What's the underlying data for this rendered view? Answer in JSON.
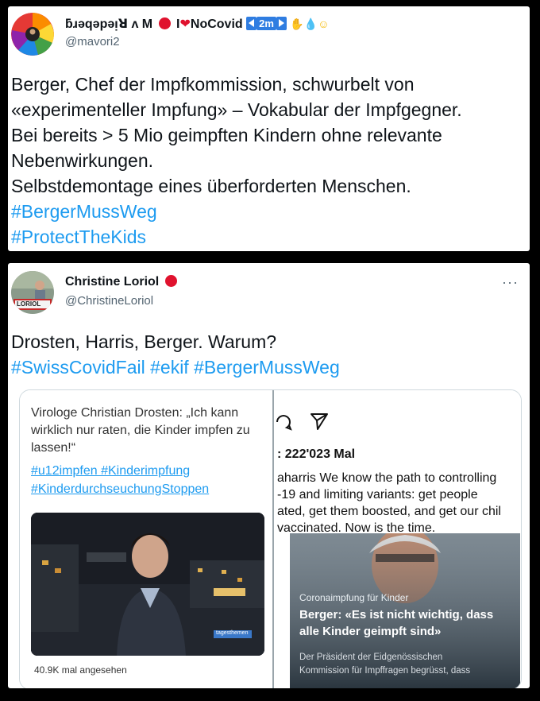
{
  "tweet1": {
    "display_name": "ƃɹǝqǝpǝᴉꓤ ʌ M",
    "nocovid": "NoCovid",
    "badge": "2m",
    "handle": "@mavori2",
    "more": "···",
    "lines": [
      "Berger, Chef der Impfkommission, schwurbelt von",
      "«experimenteller Impfung» – Vokabular der Impfgegner.",
      "Bei bereits > 5 Mio geimpften Kindern ohne relevante",
      "Nebenwirkungen.",
      "Selbstdemontage eines überforderten Menschen."
    ],
    "hashtags": [
      "#BergerMussWeg",
      "#ProtectTheKids"
    ]
  },
  "tweet2": {
    "display_name": "Christine Loriol",
    "handle": "@ChristineLoriol",
    "more": "···",
    "avatar_sign": "LORIOL",
    "text": "Drosten, Harris, Berger. Warum?",
    "hashtags": [
      "#SwissCovidFail",
      "#ekif",
      "#BergerMussWeg"
    ],
    "left_panel": {
      "quote": "Virologe Christian Drosten: „Ich kann wirklich nur raten, die Kinder impfen zu lassen!“",
      "tags": [
        "#u12impfen #Kinderimpfung",
        "#KinderdurchseuchungStoppen"
      ],
      "video_logo": "tagesthemen",
      "views": "40.9K mal angesehen"
    },
    "right_panel": {
      "views_count": ": 222'023 Mal",
      "caption_lines": [
        "aharris We know the path to controlling",
        "-19 and limiting variants: get people",
        "ated, get them boosted, and get our chil",
        " vaccinated. Now is the time."
      ],
      "article": {
        "kicker": "Coronaimpfung für Kinder",
        "headline_lines": [
          "Berger: «Es ist nicht wichtig, dass",
          "alle Kinder geimpft sind»"
        ],
        "sub_lines": [
          "Der Präsident der Eidgenössischen",
          "Kommission für Impffragen begrüsst, dass"
        ]
      }
    }
  },
  "colors": {
    "link": "#1d9bf0",
    "text": "#0f1419",
    "muted": "#536471",
    "red_dot": "#e0122e"
  }
}
